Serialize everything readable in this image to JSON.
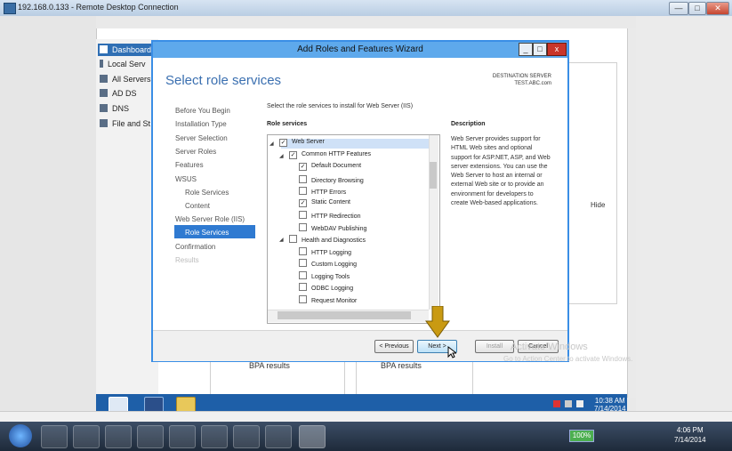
{
  "rdp": {
    "title": "192.168.0.133 - Remote Desktop Connection",
    "minimize": "—",
    "restore": "□",
    "close": "✕"
  },
  "server_manager": {
    "nav": [
      "Dashboard",
      "Local Serv",
      "All Servers",
      "AD DS",
      "DNS",
      "File and St"
    ],
    "bpa_1": "BPA results",
    "bpa_2": "BPA results",
    "hide": "Hide",
    "clock_time": "10:38 AM",
    "clock_date": "7/14/2014"
  },
  "wizard": {
    "title": "Add Roles and Features Wizard",
    "page_title": "Select role services",
    "destination_label": "DESTINATION SERVER",
    "destination_value": "TEST.ABC.com",
    "steps": [
      {
        "label": "Before You Begin"
      },
      {
        "label": "Installation Type"
      },
      {
        "label": "Server Selection"
      },
      {
        "label": "Server Roles"
      },
      {
        "label": "Features"
      },
      {
        "label": "WSUS"
      },
      {
        "label": "Role Services"
      },
      {
        "label": "Content"
      },
      {
        "label": "Web Server Role (IIS)"
      },
      {
        "label": "Role Services"
      },
      {
        "label": "Confirmation"
      },
      {
        "label": "Results"
      }
    ],
    "instruction": "Select the role services to install for Web Server (IIS)",
    "role_services_header": "Role services",
    "description_header": "Description",
    "description": "Web Server provides support for HTML Web sites and optional support for ASP.NET, ASP, and Web server extensions. You can use the Web Server to host an internal or external Web site or to provide an environment for developers to create Web-based applications.",
    "tree": [
      {
        "label": "Web Server",
        "checked": true
      },
      {
        "label": "Common HTTP Features",
        "checked": true
      },
      {
        "label": "Default Document",
        "checked": true
      },
      {
        "label": "Directory Browsing",
        "checked": false
      },
      {
        "label": "HTTP Errors",
        "checked": false
      },
      {
        "label": "Static Content",
        "checked": true
      },
      {
        "label": "HTTP Redirection",
        "checked": false
      },
      {
        "label": "WebDAV Publishing",
        "checked": false
      },
      {
        "label": "Health and Diagnostics",
        "checked": false
      },
      {
        "label": "HTTP Logging",
        "checked": false
      },
      {
        "label": "Custom Logging",
        "checked": false
      },
      {
        "label": "Logging Tools",
        "checked": false
      },
      {
        "label": "ODBC Logging",
        "checked": false
      },
      {
        "label": "Request Monitor",
        "checked": false
      }
    ],
    "buttons": {
      "previous": "< Previous",
      "next": "Next >",
      "install": "Install",
      "cancel": "Cancel"
    },
    "watermark_1": "Activate Windows",
    "watermark_2": "Go to Action Center to activate Windows."
  },
  "host_taskbar": {
    "battery": "100%",
    "time": "4:06 PM",
    "date": "7/14/2014"
  },
  "colors": {
    "wizard_border": "#3a8ee6",
    "selected_step": "#2f7ad1",
    "page_title": "#3a6fb0",
    "server_taskbar": "#1e5fa8"
  }
}
